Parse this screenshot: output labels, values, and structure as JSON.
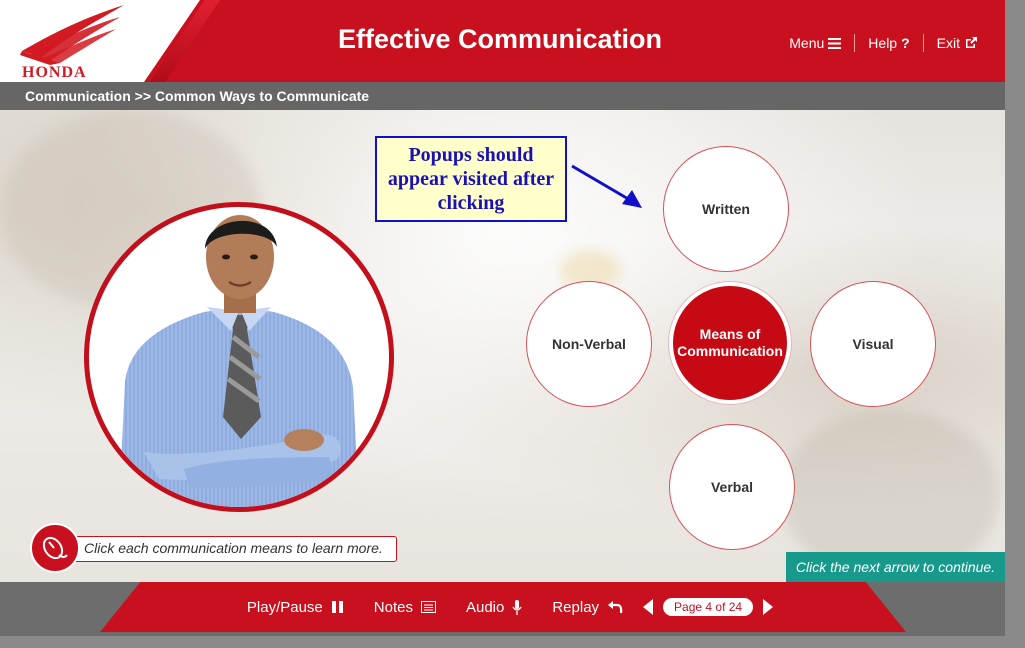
{
  "header": {
    "brand": "HONDA",
    "title": "Effective Communication",
    "nav": {
      "menu": "Menu",
      "help": "Help",
      "exit": "Exit"
    }
  },
  "breadcrumb": "Communication >> Common Ways to Communicate",
  "annotation": "Popups should appear visited after clicking",
  "diagram": {
    "center": "Means of Communication",
    "means": {
      "written": "Written",
      "visual": "Visual",
      "verbal": "Verbal",
      "non_verbal": "Non-Verbal"
    }
  },
  "instruction": "Click each communication means to learn more.",
  "next_hint": "Click the next arrow to continue.",
  "footer": {
    "play_pause": "Play/Pause",
    "notes": "Notes",
    "audio": "Audio",
    "replay": "Replay",
    "page": "Page 4 of 24"
  },
  "colors": {
    "brand_red": "#c8101e",
    "teal": "#179a8b",
    "annotation_blue": "#1a10b4"
  }
}
